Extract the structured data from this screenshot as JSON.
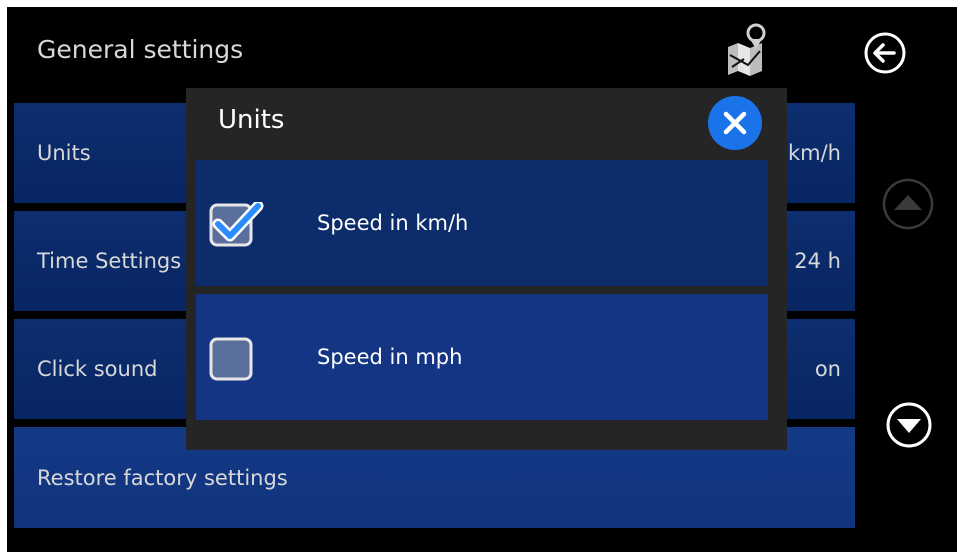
{
  "header": {
    "title": "General settings",
    "map_icon": "map-pin-icon",
    "back_icon": "back-arrow-icon"
  },
  "settings": {
    "units": {
      "label": "Units",
      "value": "km/h"
    },
    "time": {
      "label": "Time Settings",
      "value": "24 h"
    },
    "click_sound": {
      "label": "Click sound",
      "value": "on"
    },
    "restore": {
      "label": "Restore factory settings"
    }
  },
  "nav": {
    "up_icon": "scroll-up-icon",
    "down_icon": "scroll-down-icon"
  },
  "dialog": {
    "title": "Units",
    "close_icon": "close-icon",
    "options": [
      {
        "label": "Speed in km/h",
        "checked": true
      },
      {
        "label": "Speed in mph",
        "checked": false
      }
    ]
  },
  "colors": {
    "background": "#000000",
    "row_blue": "#0b2a6b",
    "dialog_bg": "#252525",
    "accent_blue": "#1a73e8",
    "check_blue": "#2b8cff"
  }
}
